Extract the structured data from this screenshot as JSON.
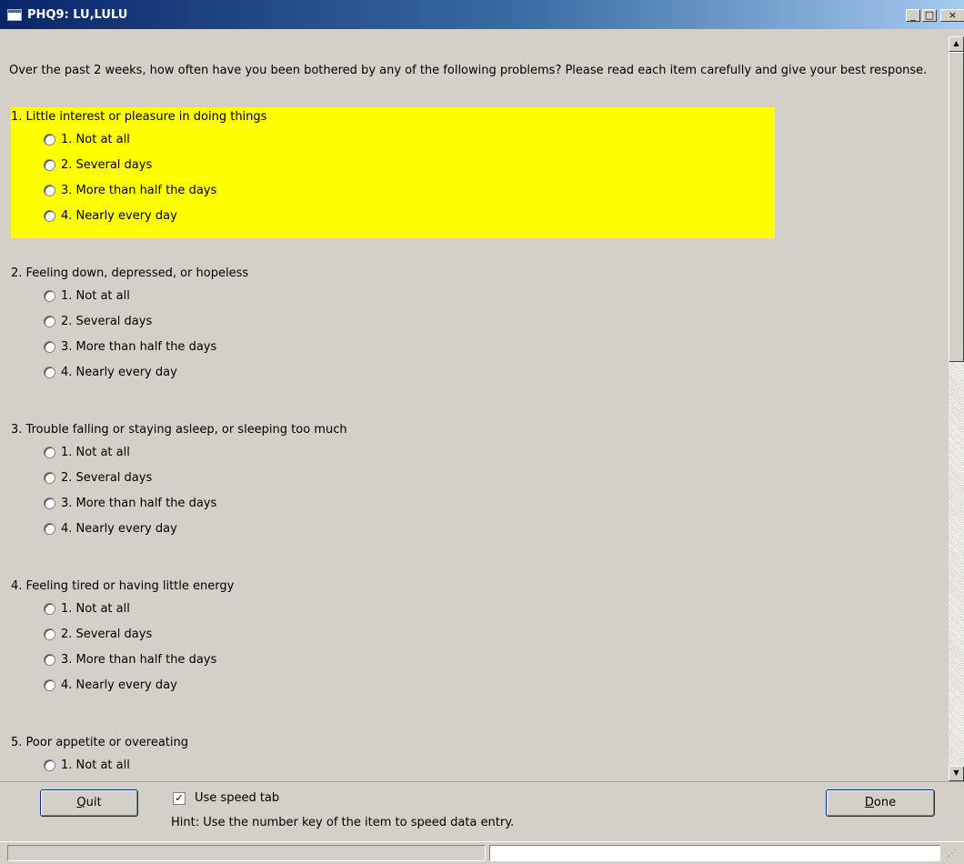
{
  "window": {
    "title": "PHQ9: LU,LULU"
  },
  "titlebar_buttons": {
    "minimize": "_",
    "maximize": "□",
    "close": "×"
  },
  "intro": "Over the past 2 weeks, how often have you been bothered by any of the following problems? Please read each item carefully and give your best response.",
  "questions": [
    {
      "label": "1. Little interest or pleasure in doing things",
      "highlighted": true,
      "options": [
        "1. Not at all",
        "2. Several days",
        "3. More than half the days",
        "4. Nearly every day"
      ]
    },
    {
      "label": "2. Feeling down, depressed, or hopeless",
      "highlighted": false,
      "options": [
        "1. Not at all",
        "2. Several days",
        "3. More than half the days",
        "4. Nearly every day"
      ]
    },
    {
      "label": "3. Trouble falling or staying asleep, or sleeping too much",
      "highlighted": false,
      "options": [
        "1. Not at all",
        "2. Several days",
        "3. More than half the days",
        "4. Nearly every day"
      ]
    },
    {
      "label": "4. Feeling tired or having little energy",
      "highlighted": false,
      "options": [
        "1. Not at all",
        "2. Several days",
        "3. More than half the days",
        "4. Nearly every day"
      ]
    },
    {
      "label": "5. Poor appetite or overeating",
      "highlighted": false,
      "options": [
        "1. Not at all"
      ]
    }
  ],
  "footer": {
    "quit_label_ul": "Q",
    "quit_label_rest": "uit",
    "done_label_ul": "D",
    "done_label_rest": "one",
    "speed_tab_label": "Use speed tab",
    "speed_tab_checked": true,
    "hint": "Hint: Use the number key of the item to speed data entry."
  },
  "colors": {
    "highlight": "#ffff00",
    "face": "#d4d0c8",
    "title_start": "#0a246a",
    "title_end": "#a6caf0"
  }
}
